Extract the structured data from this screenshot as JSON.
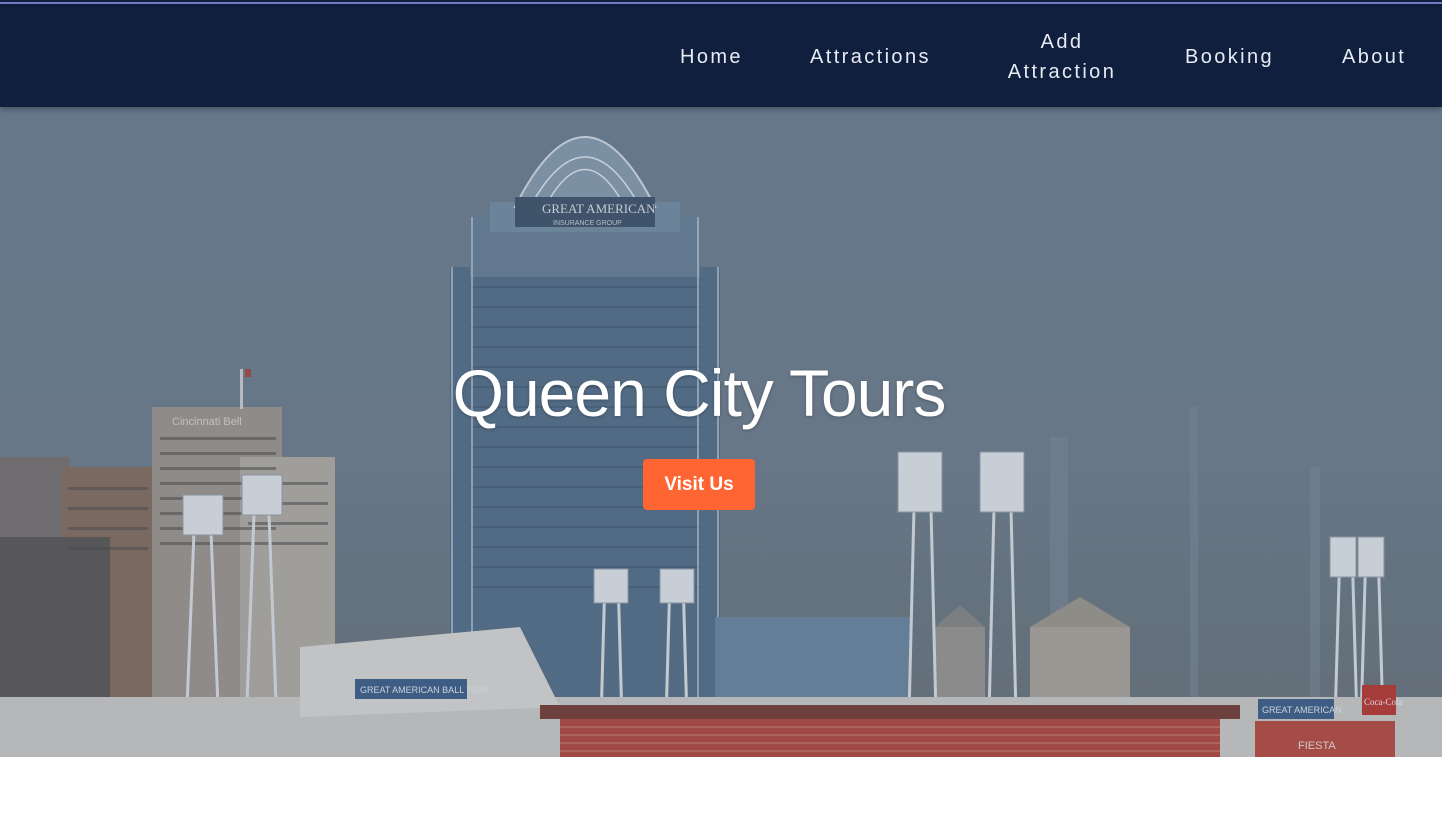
{
  "nav": {
    "items": [
      {
        "label": "Home"
      },
      {
        "label": "Attractions"
      },
      {
        "label": "Add Attraction"
      },
      {
        "label": "Booking"
      },
      {
        "label": "About"
      }
    ]
  },
  "hero": {
    "title": "Queen City Tours",
    "button_label": "Visit Us",
    "signs": {
      "tower": "GREAT AMERICAN",
      "tower_sub": "INSURANCE GROUP",
      "building": "Cincinnati Bell",
      "ballpark": "GREAT AMERICAN BALL PARK",
      "right_board": "GREAT AMERICAN",
      "fiesta": "FIESTA",
      "cola": "Coca-Cola"
    }
  },
  "colors": {
    "navbar": "#101f3d",
    "nav_text": "#e8ebf3",
    "button": "#ff6533",
    "hero_sky": "#6f8192"
  }
}
